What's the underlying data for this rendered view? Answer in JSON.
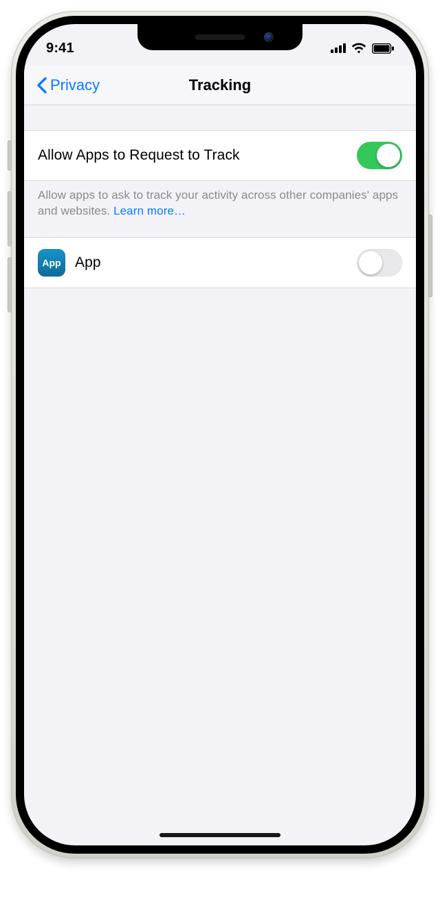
{
  "status": {
    "time": "9:41"
  },
  "nav": {
    "back_label": "Privacy",
    "title": "Tracking"
  },
  "allow": {
    "title": "Allow Apps to Request to Track",
    "on": true,
    "footer_text": "Allow apps to ask to track your activity across other companies' apps and websites. ",
    "learn_more": "Learn more…"
  },
  "apps": [
    {
      "name": "App",
      "icon_label": "App",
      "tracking": false
    }
  ]
}
